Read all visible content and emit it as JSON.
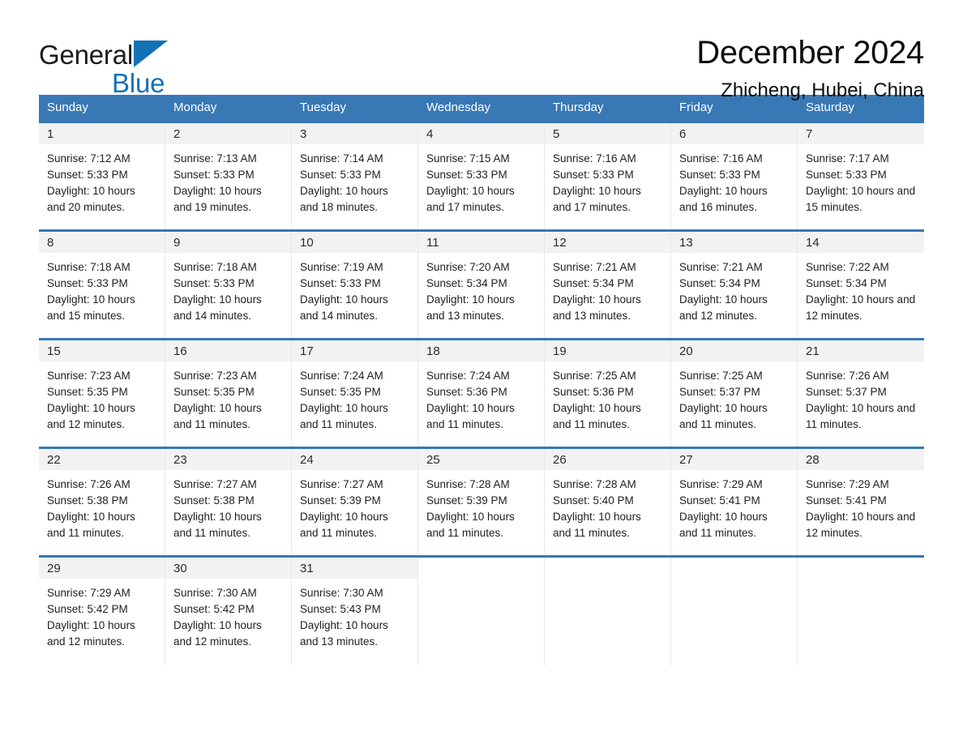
{
  "brand": {
    "word1": "General",
    "word2": "Blue",
    "triangle_color": "#1272b8",
    "icon": "triangle-logo-icon"
  },
  "header": {
    "title": "December 2024",
    "subtitle": "Zhicheng, Hubei, China"
  },
  "theme": {
    "header_blue": "#3878b5",
    "daynum_band": "#f2f2f2",
    "brand_blue": "#1272b8"
  },
  "weekdays": [
    "Sunday",
    "Monday",
    "Tuesday",
    "Wednesday",
    "Thursday",
    "Friday",
    "Saturday"
  ],
  "weeks": [
    [
      {
        "day": "1",
        "sunrise": "Sunrise: 7:12 AM",
        "sunset": "Sunset: 5:33 PM",
        "daylight": "Daylight: 10 hours and 20 minutes."
      },
      {
        "day": "2",
        "sunrise": "Sunrise: 7:13 AM",
        "sunset": "Sunset: 5:33 PM",
        "daylight": "Daylight: 10 hours and 19 minutes."
      },
      {
        "day": "3",
        "sunrise": "Sunrise: 7:14 AM",
        "sunset": "Sunset: 5:33 PM",
        "daylight": "Daylight: 10 hours and 18 minutes."
      },
      {
        "day": "4",
        "sunrise": "Sunrise: 7:15 AM",
        "sunset": "Sunset: 5:33 PM",
        "daylight": "Daylight: 10 hours and 17 minutes."
      },
      {
        "day": "5",
        "sunrise": "Sunrise: 7:16 AM",
        "sunset": "Sunset: 5:33 PM",
        "daylight": "Daylight: 10 hours and 17 minutes."
      },
      {
        "day": "6",
        "sunrise": "Sunrise: 7:16 AM",
        "sunset": "Sunset: 5:33 PM",
        "daylight": "Daylight: 10 hours and 16 minutes."
      },
      {
        "day": "7",
        "sunrise": "Sunrise: 7:17 AM",
        "sunset": "Sunset: 5:33 PM",
        "daylight": "Daylight: 10 hours and 15 minutes."
      }
    ],
    [
      {
        "day": "8",
        "sunrise": "Sunrise: 7:18 AM",
        "sunset": "Sunset: 5:33 PM",
        "daylight": "Daylight: 10 hours and 15 minutes."
      },
      {
        "day": "9",
        "sunrise": "Sunrise: 7:18 AM",
        "sunset": "Sunset: 5:33 PM",
        "daylight": "Daylight: 10 hours and 14 minutes."
      },
      {
        "day": "10",
        "sunrise": "Sunrise: 7:19 AM",
        "sunset": "Sunset: 5:33 PM",
        "daylight": "Daylight: 10 hours and 14 minutes."
      },
      {
        "day": "11",
        "sunrise": "Sunrise: 7:20 AM",
        "sunset": "Sunset: 5:34 PM",
        "daylight": "Daylight: 10 hours and 13 minutes."
      },
      {
        "day": "12",
        "sunrise": "Sunrise: 7:21 AM",
        "sunset": "Sunset: 5:34 PM",
        "daylight": "Daylight: 10 hours and 13 minutes."
      },
      {
        "day": "13",
        "sunrise": "Sunrise: 7:21 AM",
        "sunset": "Sunset: 5:34 PM",
        "daylight": "Daylight: 10 hours and 12 minutes."
      },
      {
        "day": "14",
        "sunrise": "Sunrise: 7:22 AM",
        "sunset": "Sunset: 5:34 PM",
        "daylight": "Daylight: 10 hours and 12 minutes."
      }
    ],
    [
      {
        "day": "15",
        "sunrise": "Sunrise: 7:23 AM",
        "sunset": "Sunset: 5:35 PM",
        "daylight": "Daylight: 10 hours and 12 minutes."
      },
      {
        "day": "16",
        "sunrise": "Sunrise: 7:23 AM",
        "sunset": "Sunset: 5:35 PM",
        "daylight": "Daylight: 10 hours and 11 minutes."
      },
      {
        "day": "17",
        "sunrise": "Sunrise: 7:24 AM",
        "sunset": "Sunset: 5:35 PM",
        "daylight": "Daylight: 10 hours and 11 minutes."
      },
      {
        "day": "18",
        "sunrise": "Sunrise: 7:24 AM",
        "sunset": "Sunset: 5:36 PM",
        "daylight": "Daylight: 10 hours and 11 minutes."
      },
      {
        "day": "19",
        "sunrise": "Sunrise: 7:25 AM",
        "sunset": "Sunset: 5:36 PM",
        "daylight": "Daylight: 10 hours and 11 minutes."
      },
      {
        "day": "20",
        "sunrise": "Sunrise: 7:25 AM",
        "sunset": "Sunset: 5:37 PM",
        "daylight": "Daylight: 10 hours and 11 minutes."
      },
      {
        "day": "21",
        "sunrise": "Sunrise: 7:26 AM",
        "sunset": "Sunset: 5:37 PM",
        "daylight": "Daylight: 10 hours and 11 minutes."
      }
    ],
    [
      {
        "day": "22",
        "sunrise": "Sunrise: 7:26 AM",
        "sunset": "Sunset: 5:38 PM",
        "daylight": "Daylight: 10 hours and 11 minutes."
      },
      {
        "day": "23",
        "sunrise": "Sunrise: 7:27 AM",
        "sunset": "Sunset: 5:38 PM",
        "daylight": "Daylight: 10 hours and 11 minutes."
      },
      {
        "day": "24",
        "sunrise": "Sunrise: 7:27 AM",
        "sunset": "Sunset: 5:39 PM",
        "daylight": "Daylight: 10 hours and 11 minutes."
      },
      {
        "day": "25",
        "sunrise": "Sunrise: 7:28 AM",
        "sunset": "Sunset: 5:39 PM",
        "daylight": "Daylight: 10 hours and 11 minutes."
      },
      {
        "day": "26",
        "sunrise": "Sunrise: 7:28 AM",
        "sunset": "Sunset: 5:40 PM",
        "daylight": "Daylight: 10 hours and 11 minutes."
      },
      {
        "day": "27",
        "sunrise": "Sunrise: 7:29 AM",
        "sunset": "Sunset: 5:41 PM",
        "daylight": "Daylight: 10 hours and 11 minutes."
      },
      {
        "day": "28",
        "sunrise": "Sunrise: 7:29 AM",
        "sunset": "Sunset: 5:41 PM",
        "daylight": "Daylight: 10 hours and 12 minutes."
      }
    ],
    [
      {
        "day": "29",
        "sunrise": "Sunrise: 7:29 AM",
        "sunset": "Sunset: 5:42 PM",
        "daylight": "Daylight: 10 hours and 12 minutes."
      },
      {
        "day": "30",
        "sunrise": "Sunrise: 7:30 AM",
        "sunset": "Sunset: 5:42 PM",
        "daylight": "Daylight: 10 hours and 12 minutes."
      },
      {
        "day": "31",
        "sunrise": "Sunrise: 7:30 AM",
        "sunset": "Sunset: 5:43 PM",
        "daylight": "Daylight: 10 hours and 13 minutes."
      },
      {
        "day": "",
        "sunrise": "",
        "sunset": "",
        "daylight": ""
      },
      {
        "day": "",
        "sunrise": "",
        "sunset": "",
        "daylight": ""
      },
      {
        "day": "",
        "sunrise": "",
        "sunset": "",
        "daylight": ""
      },
      {
        "day": "",
        "sunrise": "",
        "sunset": "",
        "daylight": ""
      }
    ]
  ]
}
